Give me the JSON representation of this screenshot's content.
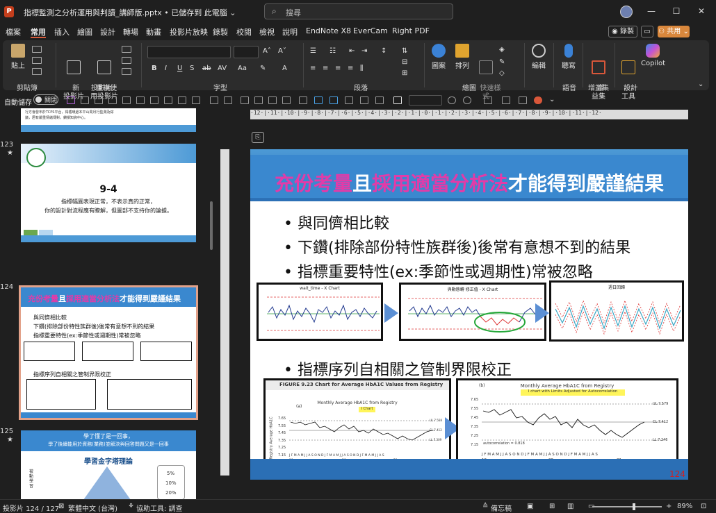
{
  "window": {
    "file_title": "指標監測之分析運用與判讀_講師版.pptx • 已儲存到 此電腦 ⌄",
    "search_placeholder": "搜尋",
    "minimize": "—",
    "maximize": "☐",
    "close": "✕"
  },
  "menu": {
    "items": [
      "檔案",
      "常用",
      "插入",
      "繪圖",
      "設計",
      "轉場",
      "動畫",
      "投影片放映",
      "錄製",
      "校閱",
      "檢視",
      "說明",
      "EndNote X8",
      "EverCam",
      "Right PDF"
    ],
    "active": "常用",
    "record_label": "◉ 錄製",
    "share_label": "⚇ 共用 ⌄"
  },
  "ribbon": {
    "groups": [
      {
        "label": "剪貼簿"
      },
      {
        "label": "投影片"
      },
      {
        "label": "字型"
      },
      {
        "label": "段落"
      },
      {
        "label": "繪圖"
      },
      {
        "label": "語音"
      },
      {
        "label": "增益集"
      }
    ],
    "buttons": {
      "paste": "貼上",
      "new_slide": "新\n投影片",
      "reuse_slide": "重複使\n用投影片",
      "shapes": "圖案",
      "arrange": "排列",
      "quick_styles": "快速樣\n式",
      "edit": "編輯",
      "dictate": "聽寫",
      "addins": "增\n益集",
      "designer": "設計\n工具",
      "copilot": "Copilot"
    }
  },
  "qat": {
    "autosave_label": "自動儲存",
    "toggle_label": "關閉"
  },
  "thumbnails": {
    "slides": [
      {
        "number": "",
        "text": "",
        "lines": [
          "行方會發布於TCPS平台，得循環處本平山局月行監測及綜",
          "議，居有嚴重情緒傳對，鑽損知資中心。"
        ]
      },
      {
        "number": "123",
        "star": "★",
        "title": "9-4",
        "lines": [
          "指標幅圓表現正常，不表示真的正常，",
          "你的設計對流程應有瞭解，但圖部不支持你的論據。"
        ]
      },
      {
        "number": "124",
        "star": "",
        "title_parts": [
          "充份考量",
          "且",
          "採用適當分析法",
          "才能得到嚴謹結果"
        ],
        "bullets": [
          "與同儕相比較",
          "下鑽(排除部份特性族群後)後常有意想不到的結果",
          "指標重要特性(ex:季節性或週期性)常被忽略",
          "指標序列自相關之管制界限校正"
        ]
      },
      {
        "number": "125",
        "star": "★",
        "title": "學了懂了是一回事，",
        "subtitle": "學了後續能用於資務(業務)並解決與回答問題又是一回事",
        "pyramid_title": "學習金字塔理論",
        "pct1": "5%",
        "pct2": "10%",
        "pct3": "20%",
        "side_label": "被動學習"
      }
    ]
  },
  "slide": {
    "title_parts": [
      "充份考量",
      "且",
      "採用適當分析法",
      "才能得到嚴謹結果"
    ],
    "bullets": [
      "• 與同儕相比較",
      "• 下鑽(排除部份特性族群後)後常有意想不到的結果",
      "• 指標重要特性(ex:季節性或週期性)常被忽略",
      "• 指標序列自相關之管制界限校正"
    ],
    "chart1_title": "wait_time - X Chart",
    "chart2_title": "與動態轉 修正值 - X Chart",
    "chart3_title": "週日回歸",
    "figure_label": "FIGURE 9.23    Chart for Average HbA1C Values from Registry",
    "chart4_panel": "(a)",
    "chart4_title": "Monthly Average HbA1C from Registry",
    "chart4_sub": "I Chart",
    "chart4_ylabel": "Registry Average HbA1C",
    "chart4_limits": [
      "UL 7.568",
      "CL 7.412",
      "LL 7.309"
    ],
    "chart4_yticks": [
      "7.65",
      "7.55",
      "7.45",
      "7.35",
      "7.25",
      "7.15"
    ],
    "chart5_panel": "(b)",
    "chart5_title": "Monthly Average HbA1C from Registry",
    "chart5_sub": "I chart  with Limits Adjusted for Autocorrelation",
    "chart5_limits": [
      "UL 7.579",
      "CL 7.412",
      "LL 7.246"
    ],
    "chart5_yticks": [
      "7.65",
      "7.55",
      "7.45",
      "7.35",
      "7.25",
      "7.15"
    ],
    "chart5_autocorr": "autocorrelation = 0.818",
    "months": "J F M A M J J A S O N D J F M A M J J A S O N D J F M A M J J A S",
    "years": [
      "19",
      "20",
      "21"
    ],
    "page_number": "124"
  },
  "ruler": "·12·|·11·|·10·|·9·|·8·|·7·|·6·|·5·|·4·|·3·|·2·|·1·|·0·|·1·|·2·|·3·|·4·|·5·|·6·|·7·|·8·|·9·|·10·|·11·|·12·",
  "status": {
    "slide_pos": "投影片 124 / 127",
    "language": "繁體中文 (台灣)",
    "accessibility": "協助工具: 調查",
    "notes": "備忘稿",
    "zoom": "89%"
  },
  "colors": {
    "accent_pink": "#e23ba8",
    "title_blue": "#3a88cf",
    "share_orange": "#d9873c",
    "selection": "#e2a189"
  }
}
